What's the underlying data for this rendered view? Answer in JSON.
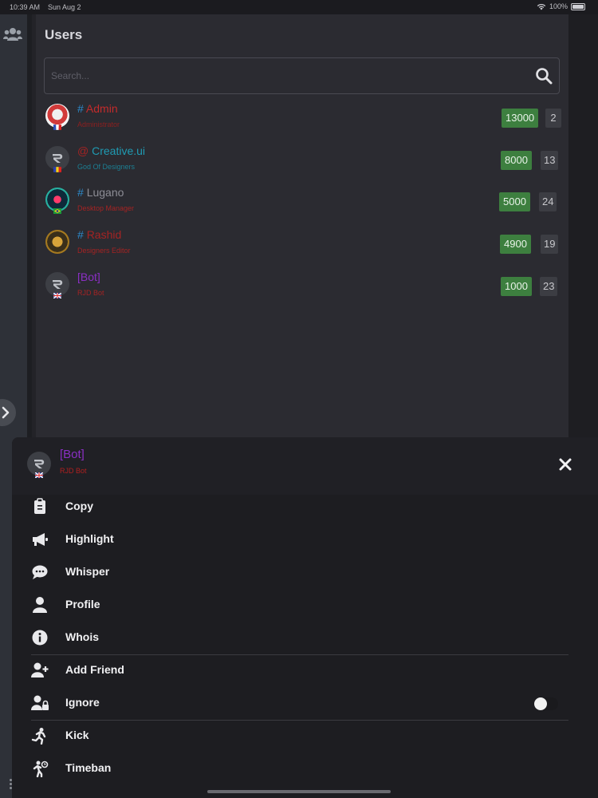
{
  "status": {
    "time": "10:39 AM",
    "date": "Sun Aug 2",
    "battery": "100%"
  },
  "sidebar": {
    "icon": "users-icon",
    "expand_icon": "chevron-right-icon"
  },
  "page": {
    "title": "Users"
  },
  "search": {
    "placeholder": "Search...",
    "icon": "search-icon"
  },
  "users": [
    {
      "prefix": "#",
      "name": "Admin",
      "role": "Administrator",
      "points": "13000",
      "count": "2",
      "name_color": "#c42b2b",
      "role_color": "#8e1f1f",
      "flag": "fr"
    },
    {
      "prefix": "@",
      "name": "Creative.ui",
      "role": "God Of Designers",
      "points": "8000",
      "count": "13",
      "name_color": "#1f9bb3",
      "role_color": "#1c7f93",
      "flag": "ro"
    },
    {
      "prefix": "#",
      "name": "Lugano",
      "role": "Desktop Manager",
      "points": "5000",
      "count": "24",
      "name_color": "#8d8d95",
      "role_color": "#a52323",
      "flag": "br"
    },
    {
      "prefix": "#",
      "name": "Rashid",
      "role": "Designers Editor",
      "points": "4900",
      "count": "19",
      "name_color": "#a52323",
      "role_color": "#a52323",
      "flag": "xx"
    },
    {
      "prefix": "",
      "name": "[Bot]",
      "role": "RJD Bot",
      "points": "1000",
      "count": "23",
      "name_color": "#8a2fc4",
      "role_color": "#a52323",
      "flag": "gb"
    }
  ],
  "sheet": {
    "user_name": "[Bot]",
    "user_role": "RJD Bot",
    "close_icon": "close-icon",
    "items": [
      {
        "label": "Copy",
        "icon": "clipboard-icon"
      },
      {
        "label": "Highlight",
        "icon": "megaphone-icon"
      },
      {
        "label": "Whisper",
        "icon": "chat-bubble-icon"
      },
      {
        "label": "Profile",
        "icon": "person-icon"
      },
      {
        "label": "Whois",
        "icon": "info-icon"
      },
      {
        "label": "Add Friend",
        "icon": "user-plus-icon"
      },
      {
        "label": "Ignore",
        "icon": "user-lock-icon",
        "toggle_on": false
      },
      {
        "label": "Kick",
        "icon": "running-person-icon"
      },
      {
        "label": "Timeban",
        "icon": "walking-timer-icon"
      }
    ]
  },
  "colors": {
    "accent_green": "#3d7f3f",
    "panel_bg": "#2b2b31",
    "sheet_bg": "#1d1d21"
  }
}
